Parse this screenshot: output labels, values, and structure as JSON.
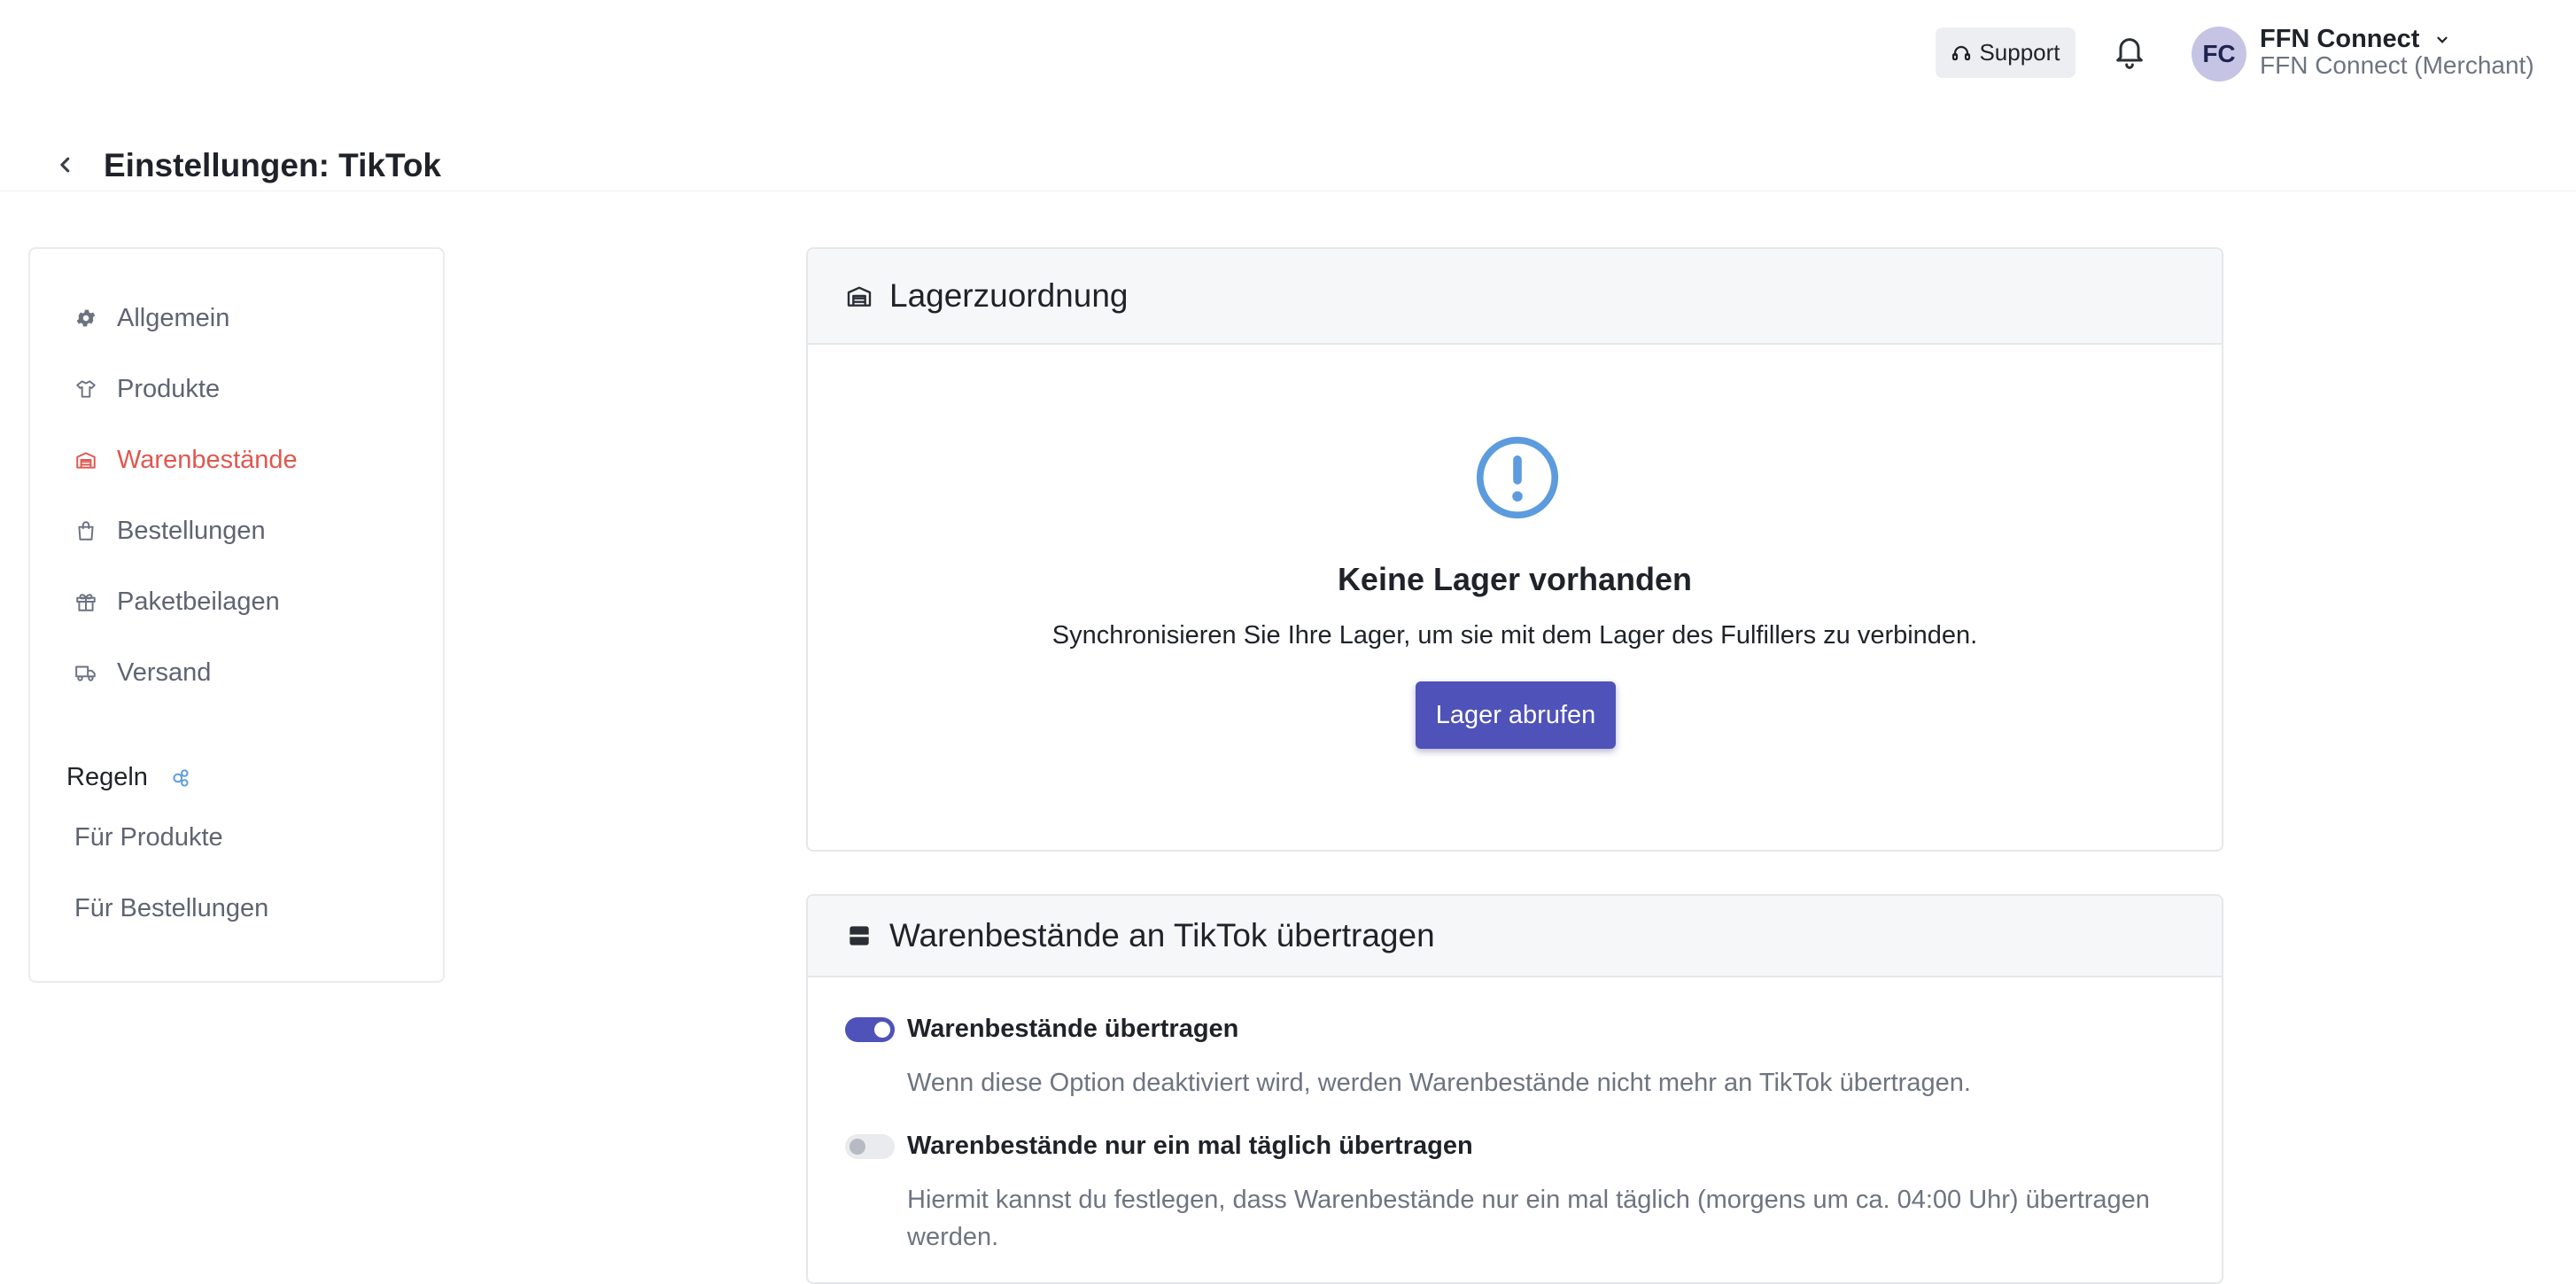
{
  "topbar": {
    "support_label": "Support",
    "icons": {
      "support": "headset-icon",
      "notifications": "bell-icon",
      "menu": "chevron-down-icon"
    },
    "user": {
      "initials": "FC",
      "name": "FFN Connect",
      "role": "FFN Connect (Merchant)"
    }
  },
  "page": {
    "title": "Einstellungen: TikTok",
    "back_icon": "chevron-left-icon"
  },
  "sidebar": {
    "items": [
      {
        "label": "Allgemein",
        "icon": "gear-icon",
        "active": false
      },
      {
        "label": "Produkte",
        "icon": "shirt-icon",
        "active": false
      },
      {
        "label": "Warenbestände",
        "icon": "warehouse-icon",
        "active": true
      },
      {
        "label": "Bestellungen",
        "icon": "shopping-bag-icon",
        "active": false
      },
      {
        "label": "Paketbeilagen",
        "icon": "gift-icon",
        "active": false
      },
      {
        "label": "Versand",
        "icon": "truck-icon",
        "active": false
      }
    ],
    "rules": {
      "title": "Regeln",
      "icon": "rules-icon",
      "items": [
        {
          "label": "Für Produkte"
        },
        {
          "label": "Für Bestellungen"
        }
      ]
    }
  },
  "warehouse_card": {
    "title": "Lagerzuordnung",
    "icon": "warehouse-icon",
    "empty_icon": "exclamation-circle-icon",
    "empty_title": "Keine Lager vorhanden",
    "empty_description": "Synchronisieren Sie Ihre Lager, um sie mit dem Lager des Fulfillers zu verbinden.",
    "button_label": "Lager abrufen"
  },
  "stock_card": {
    "title": "Warenbestände an TikTok übertragen",
    "icon": "archive-icon",
    "options": [
      {
        "label": "Warenbestände übertragen",
        "description": "Wenn diese Option deaktiviert wird, werden Warenbestände nicht mehr an TikTok übertragen.",
        "enabled": true
      },
      {
        "label": "Warenbestände nur ein mal täglich übertragen",
        "description": "Hiermit kannst du festlegen, dass Warenbestände nur ein mal täglich (morgens um ca. 04:00 Uhr) übertragen werden.",
        "enabled": false
      }
    ]
  },
  "colors": {
    "accent": "#4f52b8",
    "active_nav": "#e0574f",
    "info_icon": "#5b9bde",
    "muted_text": "#6e7480"
  }
}
